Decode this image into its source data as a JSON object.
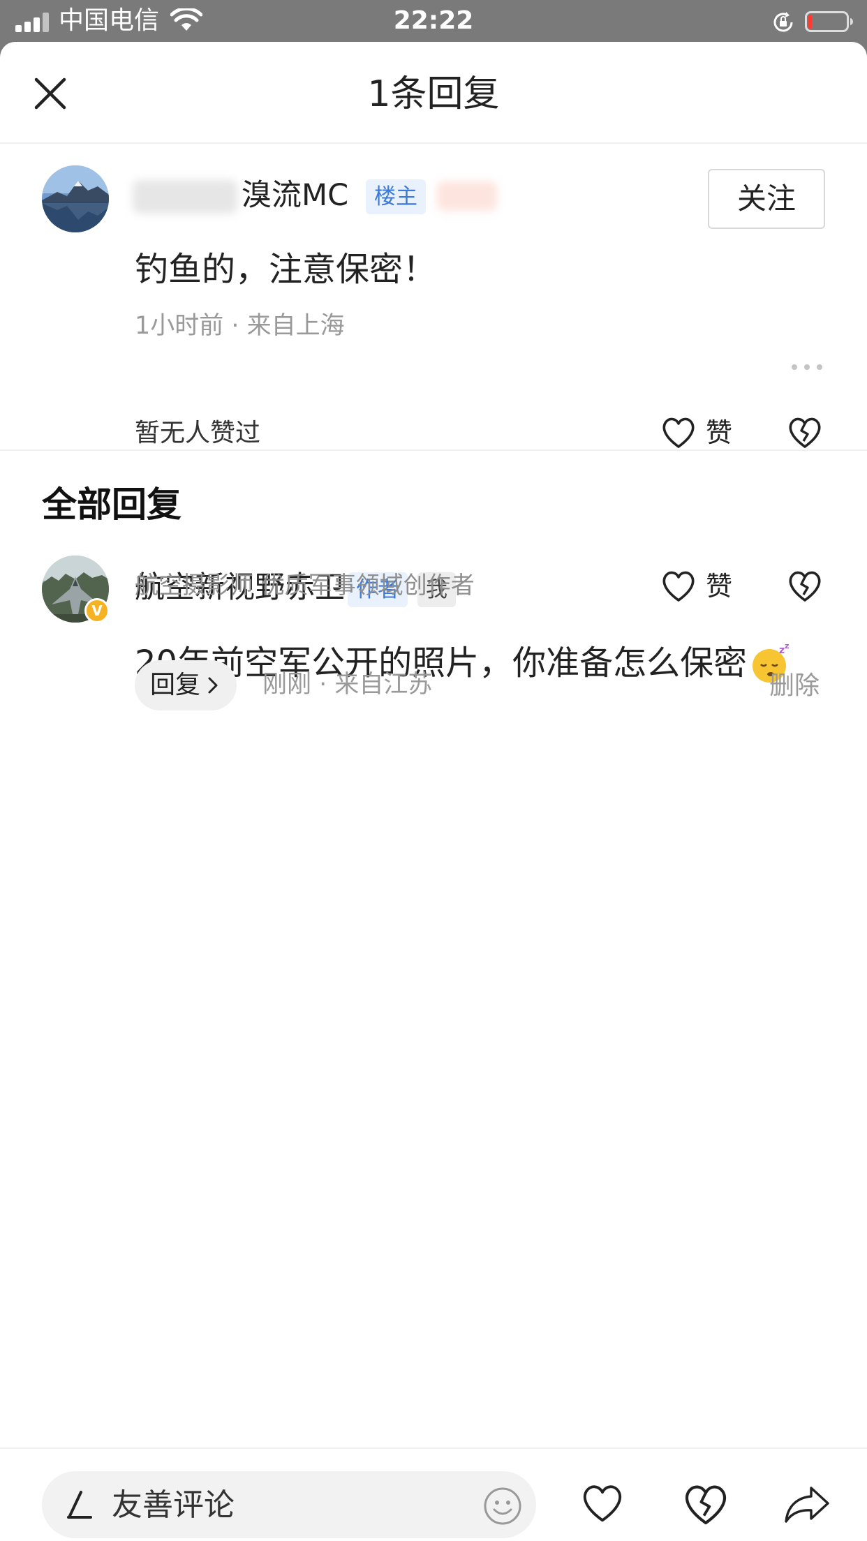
{
  "status_bar": {
    "carrier": "中国电信",
    "time": "22:22"
  },
  "header": {
    "title": "1条回复",
    "close_icon": "close-icon"
  },
  "original_comment": {
    "username_visible": "溴流MC",
    "tag": "楼主",
    "follow_label": "关注",
    "text": "钓鱼的，注意保密！",
    "meta": "1小时前 · 来自上海",
    "likes_text": "暂无人赞过",
    "like_label": "赞"
  },
  "all_replies": {
    "title": "全部回复",
    "replies": [
      {
        "username": "航空新视野赤卫",
        "tags": [
          "作者",
          "我"
        ],
        "verified_badge": "V",
        "subtitle": "航空摄影师 优质军事领域创作者",
        "text": "20年前空军公开的照片，你准备怎么保密",
        "like_label": "赞",
        "reply_label": "回复",
        "meta": "刚刚 · 来自江苏",
        "delete_label": "删除"
      }
    ]
  },
  "bottom_bar": {
    "comment_placeholder": "友善评论",
    "icons": [
      "pen-icon",
      "emoji-icon",
      "heart-icon",
      "broken-heart-icon",
      "share-icon"
    ]
  },
  "colors": {
    "tag_blue": "#3b7ad9",
    "tag_blue_bg": "#e8f1fc",
    "verified_gold": "#f5b324",
    "status_bar_bg": "#7a7a7a"
  }
}
